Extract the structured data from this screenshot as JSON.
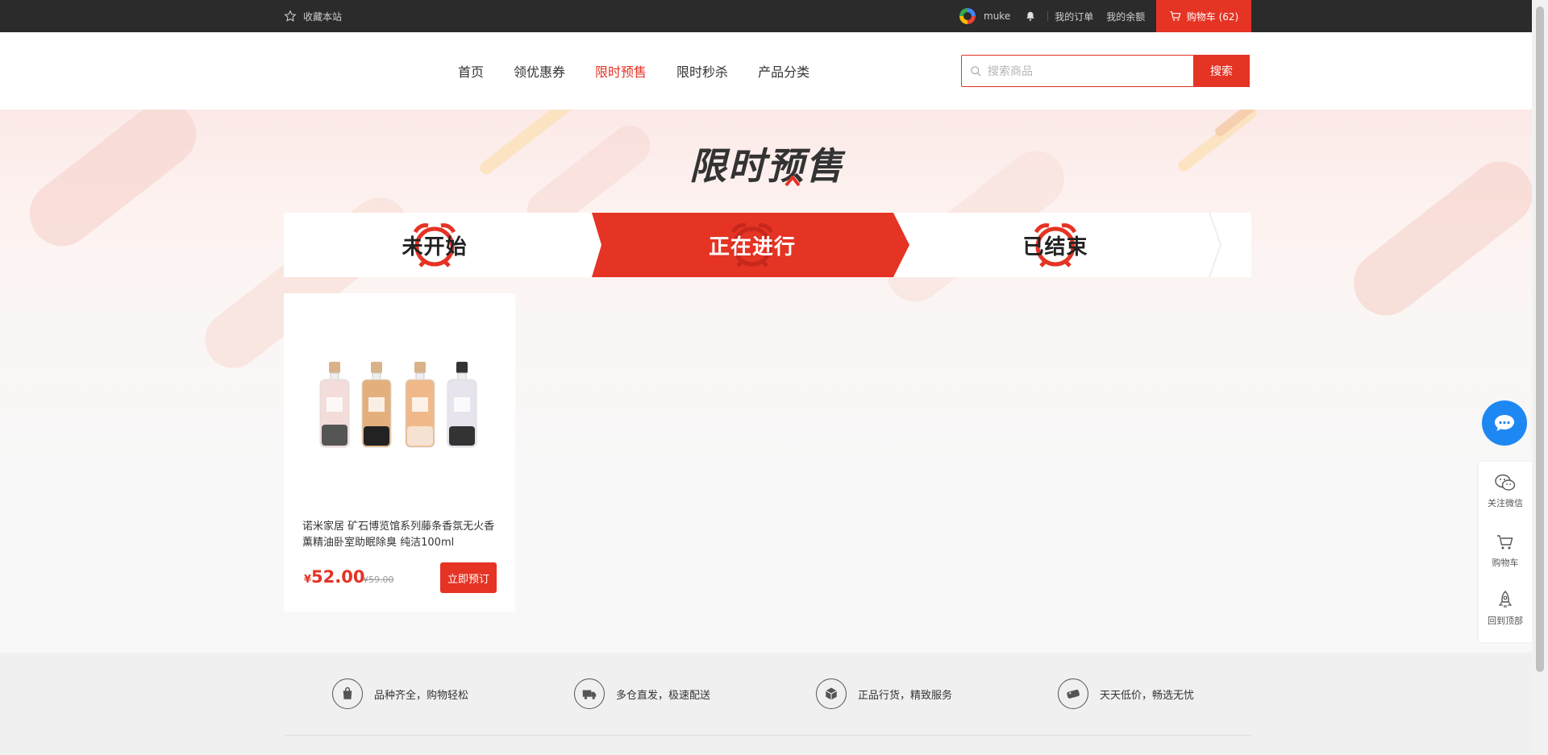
{
  "topbar": {
    "favorite_label": "收藏本站",
    "username": "muke",
    "my_orders": "我的订单",
    "my_balance": "我的余额",
    "cart_label": "购物车 (62)"
  },
  "nav": {
    "items": [
      {
        "label": "首页"
      },
      {
        "label": "领优惠券"
      },
      {
        "label": "限时预售"
      },
      {
        "label": "限时秒杀"
      },
      {
        "label": "产品分类"
      }
    ],
    "active_index": 2
  },
  "search": {
    "placeholder": "搜索商品",
    "value": "",
    "button_label": "搜索"
  },
  "banner": {
    "title": "限时预售"
  },
  "tabs": [
    {
      "label": "未开始"
    },
    {
      "label": "正在进行"
    },
    {
      "label": "已结束"
    }
  ],
  "active_tab": 1,
  "product": {
    "title": "诺米家居 矿石博览馆系列藤条香氛无火香薰精油卧室助眠除臭 纯洁100ml",
    "currency": "¥",
    "price": "52.00",
    "original_price": "¥59.00",
    "button_label": "立即预订"
  },
  "features": [
    {
      "label": "品种齐全，购物轻松",
      "icon": "bag-icon"
    },
    {
      "label": "多仓直发，极速配送",
      "icon": "truck-icon"
    },
    {
      "label": "正品行货，精致服务",
      "icon": "box-icon"
    },
    {
      "label": "天天低价，畅选无忧",
      "icon": "price-tag-icon"
    }
  ],
  "sidebar": {
    "wechat": "关注微信",
    "cart": "购物车",
    "top": "回到顶部"
  },
  "colors": {
    "accent": "#e53324",
    "topbar": "#2b2b2b",
    "chat": "#1e88f2"
  }
}
